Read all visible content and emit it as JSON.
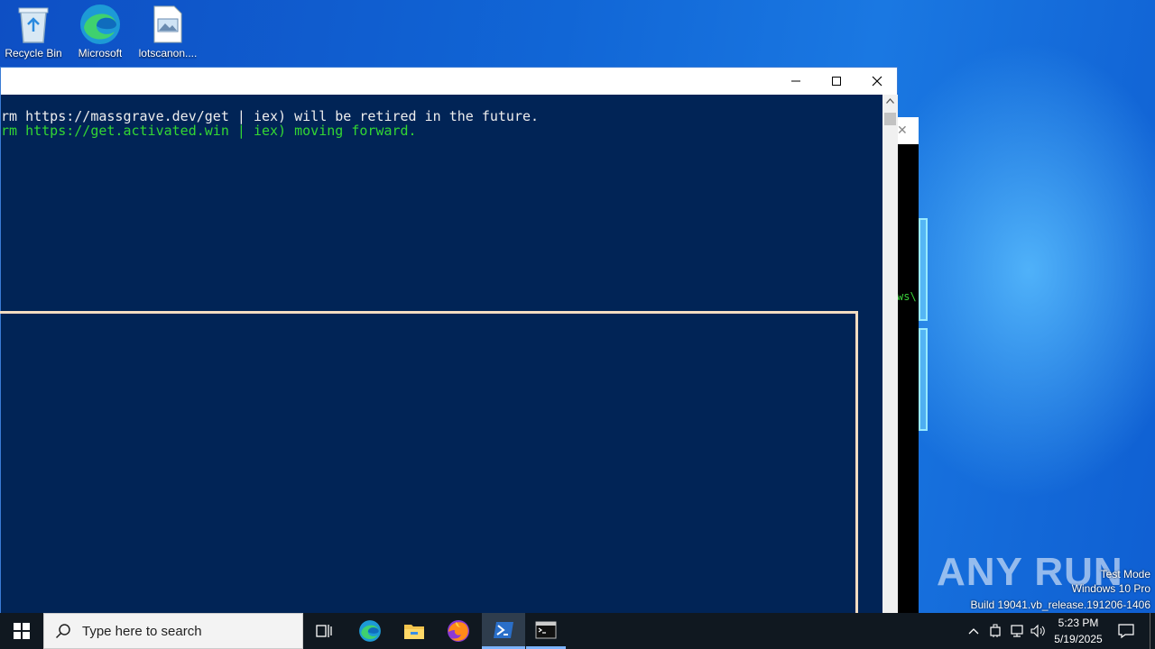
{
  "desktop": {
    "icons": [
      {
        "label": "Recycle Bin",
        "icon": "recycle-bin-icon"
      },
      {
        "label": "Microsoft",
        "icon": "edge-icon"
      },
      {
        "label": "lotscanon....",
        "icon": "image-file-icon"
      }
    ]
  },
  "background_console": {
    "visible_text": "ws\\"
  },
  "powershell": {
    "window_controls": {
      "minimize": "minimize-icon",
      "maximize": "maximize-icon",
      "close": "close-icon"
    },
    "lines": [
      "rm https://massgrave.dev/get | iex) will be retired in the future.",
      "rm https://get.activated.win | iex) moving forward."
    ],
    "colors": {
      "background": "#012456",
      "text": "#eeeeee",
      "highlight": "#33d633",
      "box_border": "#f3dcc2"
    }
  },
  "watermark": {
    "logo_text": "ANY RUN",
    "mode": "Test Mode",
    "edition": "Windows 10 Pro",
    "build": "Build 19041.vb_release.191206-1406"
  },
  "taskbar": {
    "search_placeholder": "Type here to search",
    "apps": [
      "task-view-icon",
      "edge-icon",
      "file-explorer-icon",
      "firefox-icon",
      "powershell-icon",
      "cmd-icon"
    ],
    "time": "5:23 PM",
    "date": "5/19/2025"
  }
}
